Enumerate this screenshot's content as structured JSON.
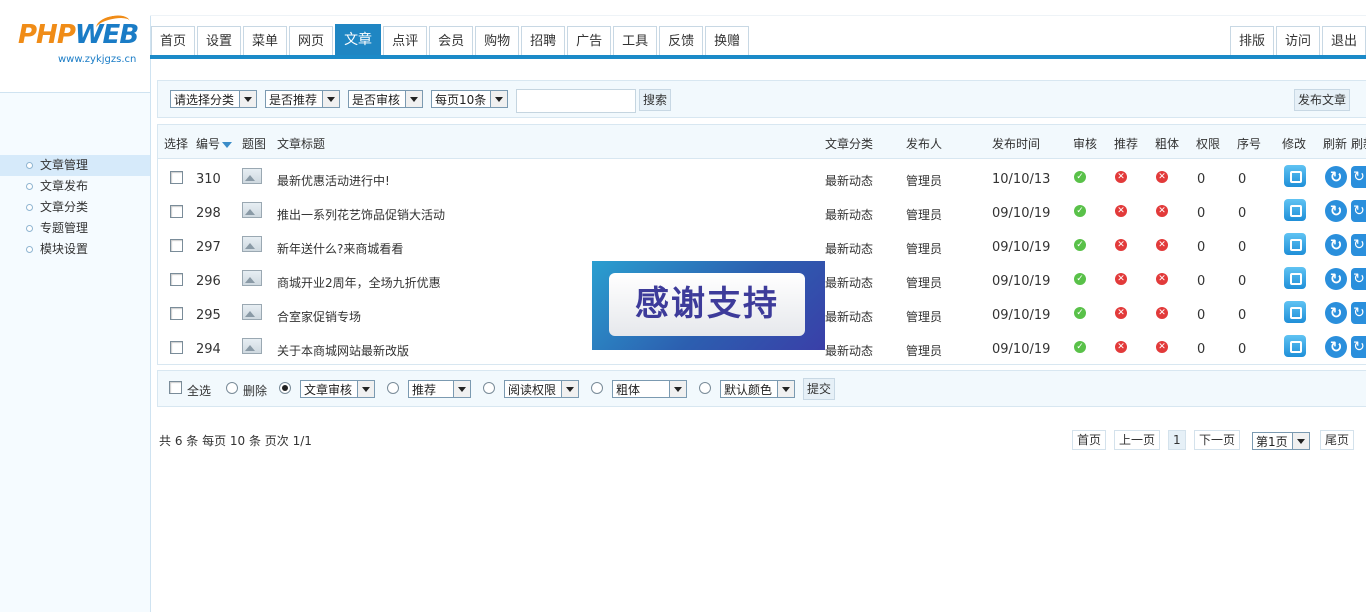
{
  "logo": {
    "brand_a": "PHP",
    "brand_b": "WEB",
    "url": "www.zykjgzs.cn"
  },
  "side_nav": [
    {
      "label": "文章管理",
      "active": true
    },
    {
      "label": "文章发布"
    },
    {
      "label": "文章分类"
    },
    {
      "label": "专题管理"
    },
    {
      "label": "模块设置"
    }
  ],
  "menu": [
    "首页",
    "设置",
    "菜单",
    "网页",
    "文章",
    "点评",
    "会员",
    "购物",
    "招聘",
    "广告",
    "工具",
    "反馈",
    "换赠"
  ],
  "menu_active": "文章",
  "menu_right": [
    "排版",
    "访问",
    "退出"
  ],
  "filters": {
    "category": "请选择分类",
    "recommend": "是否推荐",
    "audit": "是否审核",
    "per_page": "每页10条",
    "search_value": "",
    "search_button": "搜索",
    "publish_button": "发布文章"
  },
  "table": {
    "headers": {
      "select": "选择",
      "id": "编号",
      "image": "题图",
      "title": "文章标题",
      "category": "文章分类",
      "author": "发布人",
      "time": "发布时间",
      "audit": "审核",
      "recommend": "推荐",
      "bold": "粗体",
      "perm": "权限",
      "order": "序号",
      "edit": "修改",
      "refresh": "刷新",
      "refresh2": "刷新"
    },
    "rows": [
      {
        "id": "310",
        "title": "最新优惠活动进行中!",
        "category": "最新动态",
        "author": "管理员",
        "time": "10/10/13",
        "perm": "0",
        "order": "0"
      },
      {
        "id": "298",
        "title": "推出一系列花艺饰品促销大活动",
        "category": "最新动态",
        "author": "管理员",
        "time": "09/10/19",
        "perm": "0",
        "order": "0"
      },
      {
        "id": "297",
        "title": "新年送什么?来商城看看",
        "category": "最新动态",
        "author": "管理员",
        "time": "09/10/19",
        "perm": "0",
        "order": "0"
      },
      {
        "id": "296",
        "title": "商城开业2周年，全场九折优惠",
        "category": "最新动态",
        "author": "管理员",
        "time": "09/10/19",
        "perm": "0",
        "order": "0"
      },
      {
        "id": "295",
        "title": "合室家促销专场",
        "category": "最新动态",
        "author": "管理员",
        "time": "09/10/19",
        "perm": "0",
        "order": "0"
      },
      {
        "id": "294",
        "title": "关于本商城网站最新改版",
        "category": "最新动态",
        "author": "管理员",
        "time": "09/10/19",
        "perm": "0",
        "order": "0"
      }
    ]
  },
  "banner": {
    "text": "感谢支持"
  },
  "actions": {
    "select_all": "全选",
    "delete": "删除",
    "audit_select": "文章审核",
    "recommend_select": "推荐",
    "perm_select": "阅读权限",
    "bold_select": "粗体",
    "color_select": "默认颜色",
    "submit": "提交"
  },
  "pagination": {
    "summary": "共 6 条 每页 10 条 页次 1/1",
    "first": "首页",
    "prev": "上一页",
    "current": "1",
    "next": "下一页",
    "page_select": "第1页",
    "last": "尾页"
  },
  "colors": {
    "accent": "#1f86c3",
    "ok": "#59c149",
    "no": "#e23a3a"
  }
}
